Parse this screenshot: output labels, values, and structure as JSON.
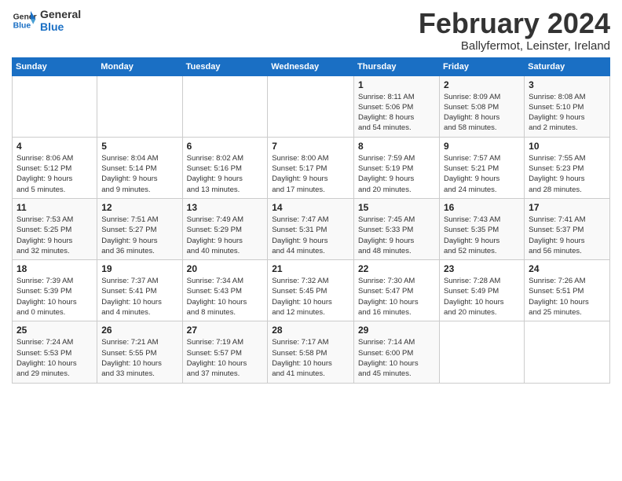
{
  "logo": {
    "line1": "General",
    "line2": "Blue"
  },
  "title": "February 2024",
  "subtitle": "Ballyfermot, Leinster, Ireland",
  "days_of_week": [
    "Sunday",
    "Monday",
    "Tuesday",
    "Wednesday",
    "Thursday",
    "Friday",
    "Saturday"
  ],
  "weeks": [
    [
      {
        "day": "",
        "info": ""
      },
      {
        "day": "",
        "info": ""
      },
      {
        "day": "",
        "info": ""
      },
      {
        "day": "",
        "info": ""
      },
      {
        "day": "1",
        "info": "Sunrise: 8:11 AM\nSunset: 5:06 PM\nDaylight: 8 hours\nand 54 minutes."
      },
      {
        "day": "2",
        "info": "Sunrise: 8:09 AM\nSunset: 5:08 PM\nDaylight: 8 hours\nand 58 minutes."
      },
      {
        "day": "3",
        "info": "Sunrise: 8:08 AM\nSunset: 5:10 PM\nDaylight: 9 hours\nand 2 minutes."
      }
    ],
    [
      {
        "day": "4",
        "info": "Sunrise: 8:06 AM\nSunset: 5:12 PM\nDaylight: 9 hours\nand 5 minutes."
      },
      {
        "day": "5",
        "info": "Sunrise: 8:04 AM\nSunset: 5:14 PM\nDaylight: 9 hours\nand 9 minutes."
      },
      {
        "day": "6",
        "info": "Sunrise: 8:02 AM\nSunset: 5:16 PM\nDaylight: 9 hours\nand 13 minutes."
      },
      {
        "day": "7",
        "info": "Sunrise: 8:00 AM\nSunset: 5:17 PM\nDaylight: 9 hours\nand 17 minutes."
      },
      {
        "day": "8",
        "info": "Sunrise: 7:59 AM\nSunset: 5:19 PM\nDaylight: 9 hours\nand 20 minutes."
      },
      {
        "day": "9",
        "info": "Sunrise: 7:57 AM\nSunset: 5:21 PM\nDaylight: 9 hours\nand 24 minutes."
      },
      {
        "day": "10",
        "info": "Sunrise: 7:55 AM\nSunset: 5:23 PM\nDaylight: 9 hours\nand 28 minutes."
      }
    ],
    [
      {
        "day": "11",
        "info": "Sunrise: 7:53 AM\nSunset: 5:25 PM\nDaylight: 9 hours\nand 32 minutes."
      },
      {
        "day": "12",
        "info": "Sunrise: 7:51 AM\nSunset: 5:27 PM\nDaylight: 9 hours\nand 36 minutes."
      },
      {
        "day": "13",
        "info": "Sunrise: 7:49 AM\nSunset: 5:29 PM\nDaylight: 9 hours\nand 40 minutes."
      },
      {
        "day": "14",
        "info": "Sunrise: 7:47 AM\nSunset: 5:31 PM\nDaylight: 9 hours\nand 44 minutes."
      },
      {
        "day": "15",
        "info": "Sunrise: 7:45 AM\nSunset: 5:33 PM\nDaylight: 9 hours\nand 48 minutes."
      },
      {
        "day": "16",
        "info": "Sunrise: 7:43 AM\nSunset: 5:35 PM\nDaylight: 9 hours\nand 52 minutes."
      },
      {
        "day": "17",
        "info": "Sunrise: 7:41 AM\nSunset: 5:37 PM\nDaylight: 9 hours\nand 56 minutes."
      }
    ],
    [
      {
        "day": "18",
        "info": "Sunrise: 7:39 AM\nSunset: 5:39 PM\nDaylight: 10 hours\nand 0 minutes."
      },
      {
        "day": "19",
        "info": "Sunrise: 7:37 AM\nSunset: 5:41 PM\nDaylight: 10 hours\nand 4 minutes."
      },
      {
        "day": "20",
        "info": "Sunrise: 7:34 AM\nSunset: 5:43 PM\nDaylight: 10 hours\nand 8 minutes."
      },
      {
        "day": "21",
        "info": "Sunrise: 7:32 AM\nSunset: 5:45 PM\nDaylight: 10 hours\nand 12 minutes."
      },
      {
        "day": "22",
        "info": "Sunrise: 7:30 AM\nSunset: 5:47 PM\nDaylight: 10 hours\nand 16 minutes."
      },
      {
        "day": "23",
        "info": "Sunrise: 7:28 AM\nSunset: 5:49 PM\nDaylight: 10 hours\nand 20 minutes."
      },
      {
        "day": "24",
        "info": "Sunrise: 7:26 AM\nSunset: 5:51 PM\nDaylight: 10 hours\nand 25 minutes."
      }
    ],
    [
      {
        "day": "25",
        "info": "Sunrise: 7:24 AM\nSunset: 5:53 PM\nDaylight: 10 hours\nand 29 minutes."
      },
      {
        "day": "26",
        "info": "Sunrise: 7:21 AM\nSunset: 5:55 PM\nDaylight: 10 hours\nand 33 minutes."
      },
      {
        "day": "27",
        "info": "Sunrise: 7:19 AM\nSunset: 5:57 PM\nDaylight: 10 hours\nand 37 minutes."
      },
      {
        "day": "28",
        "info": "Sunrise: 7:17 AM\nSunset: 5:58 PM\nDaylight: 10 hours\nand 41 minutes."
      },
      {
        "day": "29",
        "info": "Sunrise: 7:14 AM\nSunset: 6:00 PM\nDaylight: 10 hours\nand 45 minutes."
      },
      {
        "day": "",
        "info": ""
      },
      {
        "day": "",
        "info": ""
      }
    ]
  ]
}
